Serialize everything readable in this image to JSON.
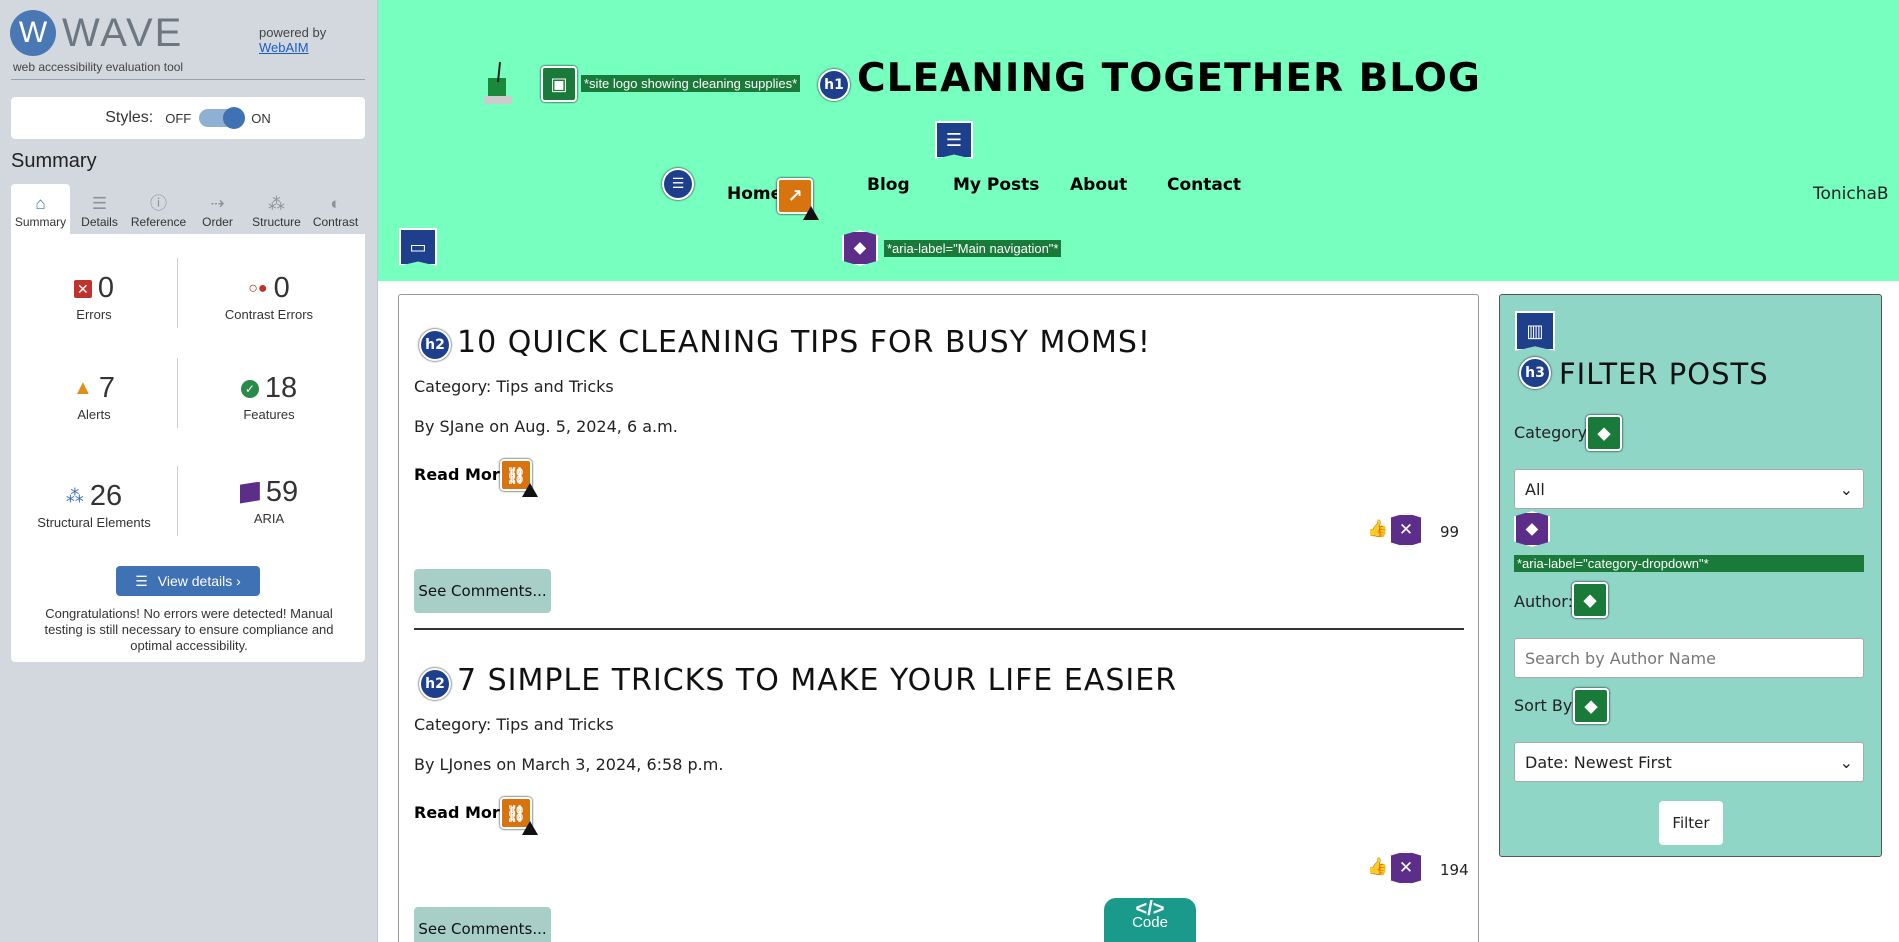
{
  "wave": {
    "logo_letter": "W",
    "name": "WAVE",
    "subtitle": "web accessibility evaluation tool",
    "powered_by": "powered by",
    "webaim": "WebAIM",
    "styles_label": "Styles:",
    "styles_off": "OFF",
    "styles_on": "ON",
    "summary_title": "Summary",
    "tabs": [
      {
        "label": "Summary",
        "icon": "⌂"
      },
      {
        "label": "Details",
        "icon": "☰"
      },
      {
        "label": "Reference",
        "icon": "ⓘ"
      },
      {
        "label": "Order",
        "icon": "⇢"
      },
      {
        "label": "Structure",
        "icon": "⁂"
      },
      {
        "label": "Contrast",
        "icon": "◐"
      }
    ],
    "stats": {
      "errors": {
        "num": "0",
        "label": "Errors"
      },
      "contrast": {
        "num": "0",
        "label": "Contrast Errors"
      },
      "alerts": {
        "num": "7",
        "label": "Alerts"
      },
      "features": {
        "num": "18",
        "label": "Features"
      },
      "structural": {
        "num": "26",
        "label": "Structural Elements"
      },
      "aria": {
        "num": "59",
        "label": "ARIA"
      }
    },
    "view_details": "View details ›",
    "congrats": "Congratulations! No errors were detected! Manual testing is still necessary to ensure compliance and optimal accessibility."
  },
  "header": {
    "title": "CLEANING TOGETHER BLOG",
    "logo_alt_label": "*site logo showing cleaning supplies*",
    "nav_aria_label": "*aria-label=\"Main navigation\"*",
    "nav": [
      "Home",
      "Blog",
      "My Posts",
      "About",
      "Contact"
    ],
    "user": "TonichaB"
  },
  "posts": [
    {
      "title": "10 QUICK CLEANING TIPS FOR BUSY MOMS!",
      "category": "Category: Tips and Tricks",
      "byline": "By SJane on Aug. 5, 2024, 6 a.m.",
      "read_more": "Read More",
      "likes": "99",
      "see_comments": "See Comments..."
    },
    {
      "title": "7 SIMPLE TRICKS TO MAKE YOUR LIFE EASIER",
      "category": "Category: Tips and Tricks",
      "byline": "By LJones on March 3, 2024, 6:58 p.m.",
      "read_more": "Read More",
      "likes": "194",
      "see_comments": "See Comments..."
    }
  ],
  "filter": {
    "title": "FILTER POSTS",
    "category_label": "Category:",
    "category_value": "All",
    "category_aria": "*aria-label=\"category-dropdown\"*",
    "author_label": "Author:",
    "author_placeholder": "Search by Author Name",
    "sort_label": "Sort By:",
    "sort_value": "Date: Newest First",
    "button": "Filter"
  },
  "code_tab": {
    "symbol": "</>",
    "label": "Code"
  },
  "wave_icons": {
    "h1": "h1",
    "h2": "h2",
    "h3": "h3"
  }
}
